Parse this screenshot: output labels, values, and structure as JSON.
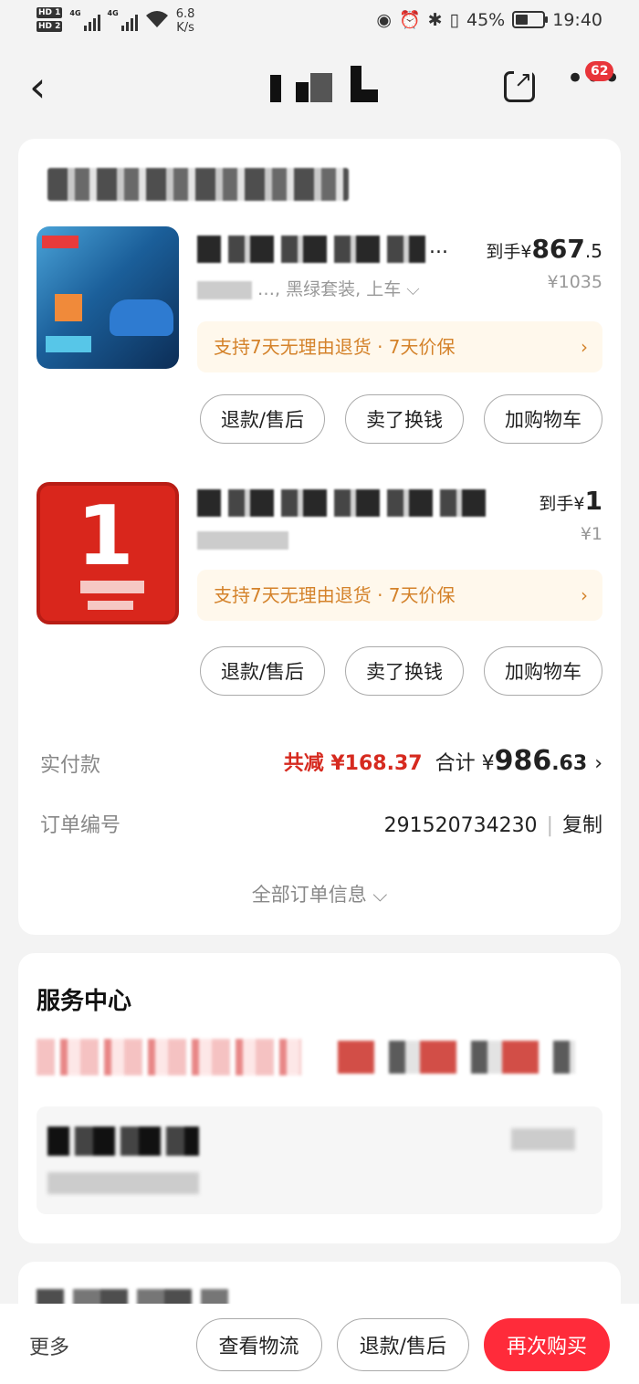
{
  "status_bar": {
    "sim1": "HD 1",
    "sim2": "HD 2",
    "net1": "4G",
    "net2": "4G",
    "speed": "6.8",
    "speed_unit": "K/s",
    "battery_pct": "45%",
    "battery_level": 0.45,
    "time": "19:40",
    "icons": [
      "eye-icon",
      "alarm-icon",
      "bluetooth-icon",
      "vibrate-icon"
    ]
  },
  "nav": {
    "back_icon": "back-chevron-icon",
    "more_badge": "62"
  },
  "items": [
    {
      "spec_suffix": "…, 黑绿套装, 上车 ⌵",
      "price_prefix": "到手¥",
      "price_int": "867",
      "price_dec": ".5",
      "orig_price": "¥1035",
      "promise": "支持7天无理由退货 · 7天价保",
      "name_ellipsis": "...",
      "buttons": [
        "退款/售后",
        "卖了换钱",
        "加购物车"
      ]
    },
    {
      "spec_suffix": "",
      "price_prefix": "到手¥",
      "price_int": "1",
      "price_dec": "",
      "orig_price": "¥1",
      "promise": "支持7天无理由退货 · 7天价保",
      "name_ellipsis": "",
      "buttons": [
        "退款/售后",
        "卖了换钱",
        "加购物车"
      ]
    }
  ],
  "summary": {
    "paid_label": "实付款",
    "reduce": "共减 ¥168.37",
    "total_prefix": "合计 ¥",
    "total_int": "986",
    "total_dec": ".63",
    "order_label": "订单编号",
    "order_no": "291520734230",
    "copy": "复制",
    "all_info": "全部订单信息 ⌵"
  },
  "service": {
    "title": "服务中心"
  },
  "bottom": {
    "more": "更多",
    "btn_logistics": "查看物流",
    "btn_refund": "退款/售后",
    "btn_rebuy": "再次购买"
  },
  "colors": {
    "accent_red": "#ff2b3a",
    "promise_orange": "#d4822a",
    "reduce_red": "#d62a1f"
  }
}
